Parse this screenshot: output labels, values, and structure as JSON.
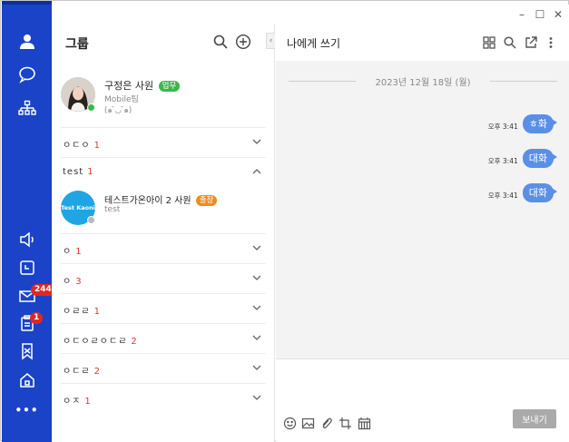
{
  "window": {
    "controls": {
      "minimize": "–",
      "maximize": "☐",
      "close": "✕"
    }
  },
  "rail": {
    "accent": "#1a43c7",
    "items": [
      {
        "name": "person-icon"
      },
      {
        "name": "chat-bubble-icon"
      },
      {
        "name": "org-chart-icon"
      },
      {
        "name": "speaker-icon"
      },
      {
        "name": "calendar-icon"
      },
      {
        "name": "mail-icon",
        "badge": "244"
      },
      {
        "name": "clipboard-icon",
        "badge": "1"
      },
      {
        "name": "bookmark-icon"
      },
      {
        "name": "home-icon"
      },
      {
        "name": "more-icon",
        "label": "•••"
      }
    ]
  },
  "group_panel": {
    "title": "그룹",
    "collapse_label": "‹",
    "me": {
      "name": "구정은",
      "rank": "사원",
      "tag": "업무",
      "tag_color": "#3cb74b",
      "team": "Mobile팀",
      "status_msg": "(๑ ̄◡ ̄๑)",
      "presence_color": "#3cb74b"
    },
    "groups": [
      {
        "name": "ㅇㄷㅇ",
        "count": "1",
        "expanded": false
      },
      {
        "name": "test",
        "count": "1",
        "expanded": true
      },
      {
        "name": "ㅇ",
        "count": "1",
        "expanded": false
      },
      {
        "name": "ㅇ",
        "count": "3",
        "expanded": false
      },
      {
        "name": "ㅇㄹㄹ",
        "count": "1",
        "expanded": false
      },
      {
        "name": "ㅇㄷㅇㄹㅇㄷㄹ",
        "count": "2",
        "expanded": false
      },
      {
        "name": "ㅇㄷㄹ",
        "count": "2",
        "expanded": false
      },
      {
        "name": "ㅇㅈ",
        "count": "1",
        "expanded": false
      }
    ],
    "member": {
      "name": "테스트가온아이 2",
      "rank": "사원",
      "tag": "출장",
      "tag_color": "#f08a24",
      "sub": "test",
      "avatar_text": "Test Kaoni",
      "presence_color": "#bbbbbb"
    }
  },
  "chat": {
    "title": "나에게 쓰기",
    "date": "2023년 12월 18일 (월)",
    "messages": [
      {
        "time": "오후 3:41",
        "text": "ㅎ화"
      },
      {
        "time": "오후 3:41",
        "text": "대화"
      },
      {
        "time": "오후 3:41",
        "text": "대화"
      }
    ],
    "bubble_color": "#5a8fe7",
    "send_label": "보내기"
  }
}
